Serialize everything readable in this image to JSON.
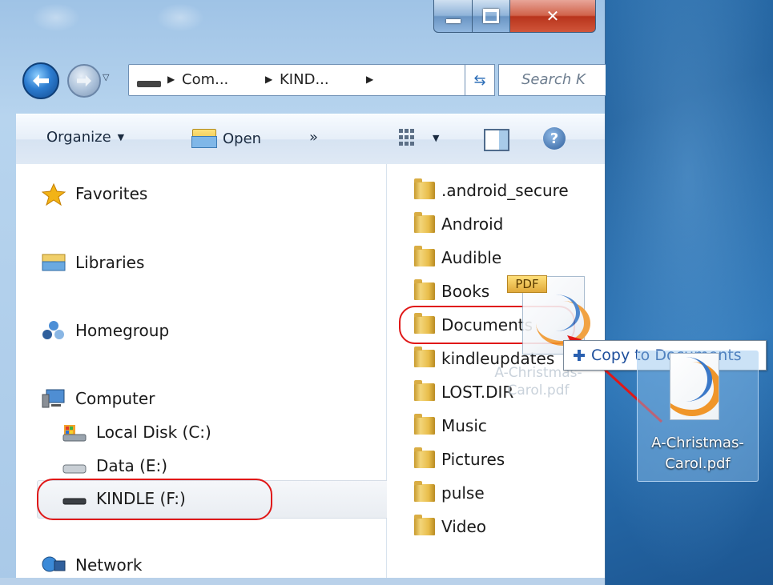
{
  "window": {
    "address": {
      "crumbs": [
        "Com...",
        "KIND..."
      ],
      "search_placeholder": "Search K"
    },
    "toolbar": {
      "organize_label": "Organize",
      "open_label": "Open",
      "more_label": "»"
    },
    "nav_pane": {
      "favorites": "Favorites",
      "libraries": "Libraries",
      "homegroup": "Homegroup",
      "computer": "Computer",
      "local_disk": "Local Disk (C:)",
      "data_drive": "Data (E:)",
      "kindle_drive": "KINDLE (F:)",
      "network": "Network"
    },
    "files": [
      ".android_secure",
      "Android",
      "Audible",
      "Books",
      "Documents",
      "kindleupdates",
      "LOST.DIR",
      "Music",
      "Pictures",
      "pulse",
      "Video"
    ]
  },
  "drag": {
    "badge": "PDF",
    "ghost_caption": "A-Christmas-Carol.pdf",
    "tooltip": "Copy to Documents"
  },
  "desktop": {
    "file_label": "A-Christmas-Carol.pdf"
  },
  "colors": {
    "highlight_red": "#e01818",
    "tooltip_text": "#1e4f9c",
    "pdf_orange": "#f0962a",
    "pdf_blue": "#3a78c8"
  },
  "icons": [
    "back-arrow-icon",
    "forward-arrow-icon",
    "refresh-icon",
    "open-folder-icon",
    "views-icon",
    "preview-pane-icon",
    "help-icon",
    "star-icon",
    "libraries-icon",
    "homegroup-icon",
    "computer-icon",
    "local-disk-icon",
    "drive-icon",
    "network-icon",
    "folder-icon",
    "pdf-file-icon",
    "plus-icon"
  ]
}
